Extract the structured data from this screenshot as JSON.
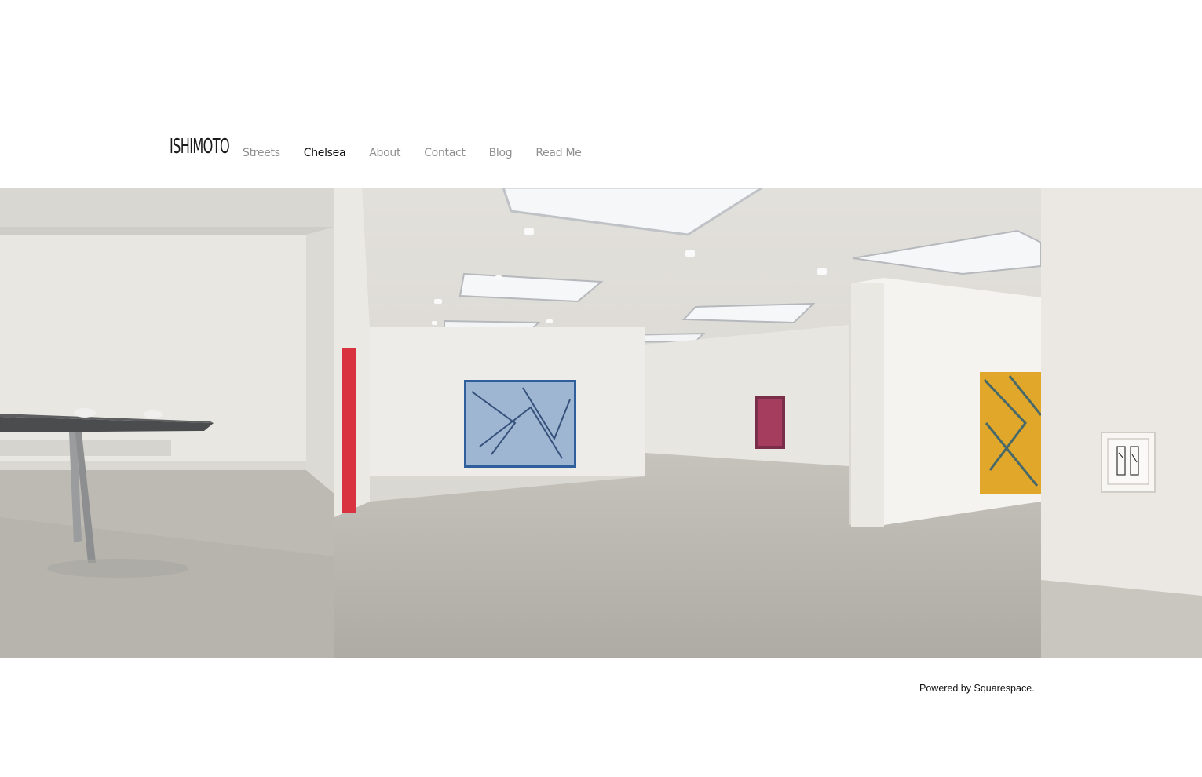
{
  "site": {
    "logo_text": "ISHIMOTO"
  },
  "nav": {
    "items": [
      {
        "label": "Streets",
        "active": false
      },
      {
        "label": "Chelsea",
        "active": true
      },
      {
        "label": "About",
        "active": false
      },
      {
        "label": "Contact",
        "active": false
      },
      {
        "label": "Blog",
        "active": false
      },
      {
        "label": "Read Me",
        "active": false
      }
    ]
  },
  "gallery": {
    "slides": [
      {
        "name": "gallery-slide-table"
      },
      {
        "name": "gallery-slide-main-room"
      },
      {
        "name": "gallery-slide-drawing"
      }
    ]
  },
  "footer": {
    "powered_by": "Powered by Squarespace."
  }
}
